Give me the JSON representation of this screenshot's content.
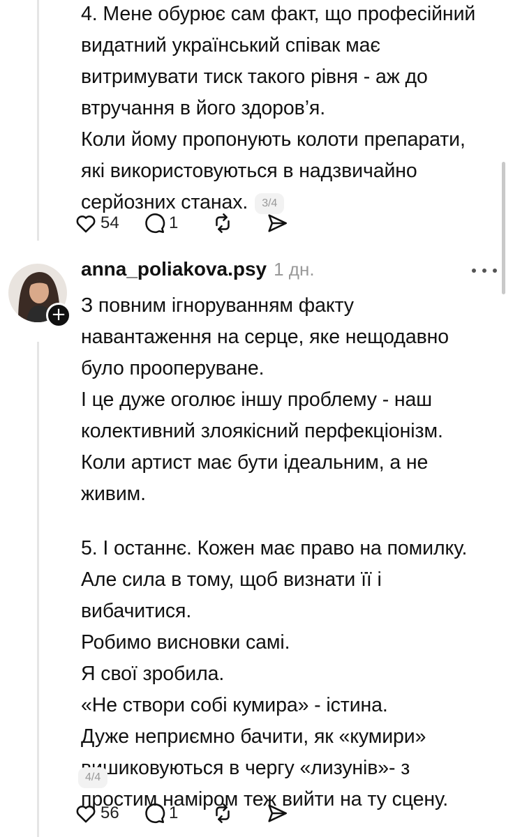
{
  "post_top": {
    "text_lines": [
      "4. Мене обурює сам факт, що професійний",
      "видатний український співак має",
      "витримувати тиск такого рівня - аж до",
      "втручання в його здоров’я.",
      "Коли йому пропонують колоти препарати,",
      "які використовуються в надзвичайно",
      "серйозних станах."
    ],
    "page_badge": "3/4",
    "likes": "54",
    "replies": "1"
  },
  "post_bottom": {
    "author": {
      "username": "anna_poliakova.psy",
      "timestamp": "1 дн."
    },
    "text_lines": [
      "З повним ігноруванням факту",
      "навантаження на серце, яке нещодавно",
      "було прооперуване.",
      "І це дуже оголює іншу проблему - наш",
      "колективний злоякісний перфекціонізм.",
      "Коли артист має бути ідеальним, а не",
      "живим.",
      "",
      "5. І останнє. Кожен має право на помилку.",
      "Але сила в тому, щоб визнати її і",
      "вибачитися.",
      "Робимо висновки самі.",
      "Я свої зробила.",
      "«Не створи собі кумира» - істина.",
      "Дуже неприємно бачити, як «кумири»",
      "вишиковуються в чергу «лизунів»- з",
      "простим наміром теж вийти на ту сцену."
    ],
    "page_badge": "4/4",
    "likes": "56",
    "replies": "1"
  },
  "icons": {
    "like": "heart-outline-icon",
    "reply": "speech-bubble-icon",
    "repost": "repost-arrows-icon",
    "share": "paper-plane-icon",
    "more": "more-dots-icon",
    "follow": "plus-icon"
  },
  "colors": {
    "text": "#111111",
    "muted": "#999999",
    "badge_bg": "#f2f2f2",
    "thread_line": "#e5e5e5"
  }
}
